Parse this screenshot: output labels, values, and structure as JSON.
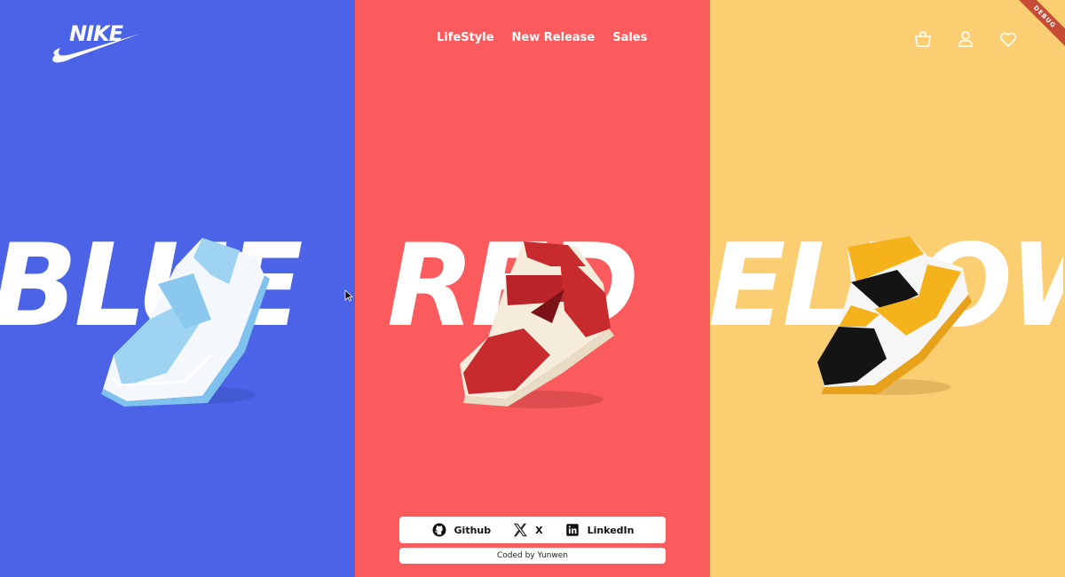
{
  "brand": {
    "logo_text": "NIKE"
  },
  "nav": {
    "items": [
      {
        "label": "LifeStyle"
      },
      {
        "label": "New Release"
      },
      {
        "label": "Sales"
      }
    ]
  },
  "header_icons": [
    "bag-icon",
    "user-icon",
    "heart-icon"
  ],
  "debug_banner": "DEBUG",
  "panels": [
    {
      "word": "BLUE",
      "shown_text": "BLUE",
      "color": "#4B63E6"
    },
    {
      "word": "RED",
      "shown_text": "RED",
      "color": "#FB5B5C"
    },
    {
      "word": "YELLOW",
      "shown_text": "ELLOW",
      "color": "#FCCE72"
    }
  ],
  "footer": {
    "links": [
      {
        "label": "Github",
        "icon": "github-icon"
      },
      {
        "label": "X",
        "icon": "x-icon"
      },
      {
        "label": "LinkedIn",
        "icon": "linkedin-icon"
      }
    ],
    "credit": "Coded by Yunwen"
  }
}
